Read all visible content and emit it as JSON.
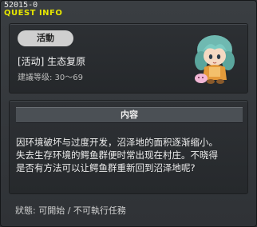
{
  "window": {
    "quest_id": "52015-0",
    "title": "QUEST INFO"
  },
  "quest": {
    "category_badge": "活動",
    "title": "[活动] 生态复原",
    "level_range": "建議等级: 30～69",
    "npc_icon": "npc-portrait-icon"
  },
  "description": {
    "header": "内容",
    "lines": [
      "因环境破坏与过度开发，沼泽地的面积逐渐缩小。",
      "失去生存环境的鳄鱼群便时常出现在村庄。不晓得",
      "是否有方法可以让鳄鱼群重新回到沼泽地呢?"
    ]
  },
  "status": {
    "text": "狀態: 可開始 / 不可執行任務"
  },
  "colors": {
    "title_yellow": "#e6e600",
    "badge_bg": "#cfcfcf",
    "panel_bg": "#2d3034"
  }
}
